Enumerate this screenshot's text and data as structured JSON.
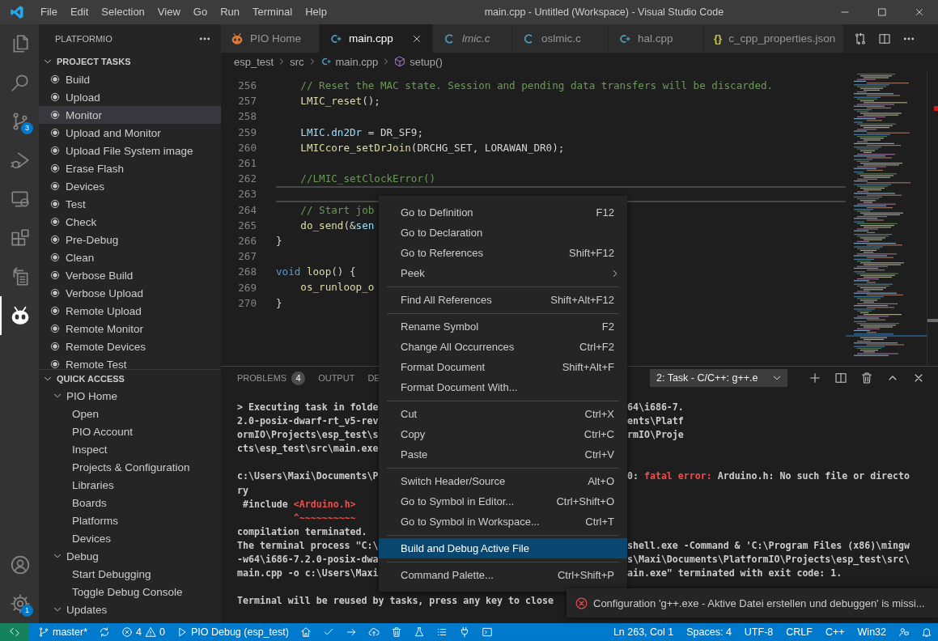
{
  "title_bar": {
    "menu": [
      "File",
      "Edit",
      "Selection",
      "View",
      "Go",
      "Run",
      "Terminal",
      "Help"
    ],
    "title": "main.cpp - Untitled (Workspace) - Visual Studio Code"
  },
  "activity_bar": {
    "items": [
      {
        "kind": "files",
        "selected": false
      },
      {
        "kind": "search",
        "selected": false
      },
      {
        "kind": "scm",
        "selected": false,
        "badge": "3"
      },
      {
        "kind": "debug",
        "selected": false
      },
      {
        "kind": "remote",
        "selected": false
      },
      {
        "kind": "extensions",
        "selected": false
      },
      {
        "kind": "tasks",
        "selected": false
      },
      {
        "kind": "platformio",
        "selected": true
      }
    ],
    "bottom": [
      {
        "kind": "account",
        "selected": false
      },
      {
        "kind": "settings",
        "selected": false,
        "badge": "1"
      }
    ]
  },
  "sidebar": {
    "title": "PLATFORMIO",
    "sections": [
      {
        "kind": "tasks",
        "title": "PROJECT TASKS",
        "expanded": true,
        "items": [
          {
            "label": "Build",
            "selected": false
          },
          {
            "label": "Upload",
            "selected": false
          },
          {
            "label": "Monitor",
            "selected": true
          },
          {
            "label": "Upload and Monitor",
            "selected": false
          },
          {
            "label": "Upload File System image",
            "selected": false
          },
          {
            "label": "Erase Flash",
            "selected": false
          },
          {
            "label": "Devices",
            "selected": false
          },
          {
            "label": "Test",
            "selected": false
          },
          {
            "label": "Check",
            "selected": false
          },
          {
            "label": "Pre-Debug",
            "selected": false
          },
          {
            "label": "Clean",
            "selected": false
          },
          {
            "label": "Verbose Build",
            "selected": false
          },
          {
            "label": "Verbose Upload",
            "selected": false
          },
          {
            "label": "Remote Upload",
            "selected": false
          },
          {
            "label": "Remote Monitor",
            "selected": false
          },
          {
            "label": "Remote Devices",
            "selected": false
          },
          {
            "label": "Remote Test",
            "selected": false
          }
        ]
      },
      {
        "kind": "tree",
        "title": "QUICK ACCESS",
        "expanded": true,
        "items": [
          {
            "label": "PIO Home",
            "expanded": true,
            "children": [
              {
                "label": "Open"
              },
              {
                "label": "PIO Account"
              },
              {
                "label": "Inspect"
              },
              {
                "label": "Projects & Configuration"
              },
              {
                "label": "Libraries"
              },
              {
                "label": "Boards"
              },
              {
                "label": "Platforms"
              },
              {
                "label": "Devices"
              }
            ]
          },
          {
            "label": "Debug",
            "expanded": true,
            "children": [
              {
                "label": "Start Debugging"
              },
              {
                "label": "Toggle Debug Console"
              }
            ]
          },
          {
            "label": "Updates",
            "expanded": true
          }
        ]
      }
    ]
  },
  "editor": {
    "tabs": [
      {
        "label": "PIO Home",
        "kind": "pio",
        "selected": false,
        "preview": false
      },
      {
        "label": "main.cpp",
        "kind": "cpp",
        "selected": true,
        "preview": false
      },
      {
        "label": "lmic.c",
        "kind": "c",
        "selected": false,
        "preview": true
      },
      {
        "label": "oslmic.c",
        "kind": "c",
        "selected": false,
        "preview": false
      },
      {
        "label": "hal.cpp",
        "kind": "cpp",
        "selected": false,
        "preview": false
      },
      {
        "label": "c_cpp_properties.json",
        "kind": "json",
        "glyph": "{}",
        "selected": false,
        "preview": false
      }
    ],
    "breadcrumbs": [
      {
        "label": "esp_test",
        "kind": "folder"
      },
      {
        "label": "src",
        "kind": "folder"
      },
      {
        "label": "main.cpp",
        "kind": "cpp"
      },
      {
        "label": "setup()",
        "kind": "function"
      }
    ],
    "lines": [
      {
        "number": "256",
        "current": false,
        "tokens": [
          {
            "color": "#6a9955",
            "text": "    // Reset the MAC state. Session and pending data transfers will be discarded."
          }
        ]
      },
      {
        "number": "257",
        "current": false,
        "tokens": [
          {
            "color": "#dcdcaa",
            "text": "    LMIC_reset"
          },
          {
            "color": "#d4d4d4",
            "text": "();"
          }
        ]
      },
      {
        "number": "258",
        "current": false
      },
      {
        "number": "259",
        "current": false,
        "tokens": [
          {
            "color": "#9cdcfe",
            "text": "    LMIC.dn2Dr"
          },
          {
            "color": "#d4d4d4",
            "text": " = DR_SF9;"
          }
        ]
      },
      {
        "number": "260",
        "current": false,
        "tokens": [
          {
            "color": "#dcdcaa",
            "text": "    LMICcore_setDrJoin"
          },
          {
            "color": "#d4d4d4",
            "text": "(DRCHG_SET, LORAWAN_DR0);"
          }
        ]
      },
      {
        "number": "261",
        "current": false
      },
      {
        "number": "262",
        "current": false,
        "tokens": [
          {
            "color": "#6a9955",
            "text": "    //LMIC_setClockError()"
          }
        ]
      },
      {
        "number": "263",
        "current": true
      },
      {
        "number": "264",
        "current": false,
        "tokens": [
          {
            "color": "#6a9955",
            "text": "    // Start job"
          }
        ]
      },
      {
        "number": "265",
        "current": false,
        "tokens": [
          {
            "color": "#dcdcaa",
            "text": "    do_send"
          },
          {
            "color": "#d4d4d4",
            "text": "(&"
          },
          {
            "color": "#9cdcfe",
            "text": "sen"
          }
        ]
      },
      {
        "number": "266",
        "current": false,
        "tokens": [
          {
            "color": "#d4d4d4",
            "text": "}"
          }
        ]
      },
      {
        "number": "267",
        "current": false
      },
      {
        "number": "268",
        "current": false,
        "tokens": [
          {
            "color": "#569cd6",
            "text": "void"
          },
          {
            "color": "#dcdcaa",
            "text": " loop"
          },
          {
            "color": "#d4d4d4",
            "text": "() {"
          }
        ]
      },
      {
        "number": "269",
        "current": false,
        "tokens": [
          {
            "color": "#dcdcaa",
            "text": "    os_runloop_o"
          }
        ]
      },
      {
        "number": "270",
        "current": false,
        "tokens": [
          {
            "color": "#d4d4d4",
            "text": "}"
          }
        ]
      }
    ]
  },
  "panel": {
    "tabs": [
      {
        "label": "PROBLEMS",
        "badge": "4",
        "selected": false
      },
      {
        "label": "OUTPUT",
        "selected": false
      },
      {
        "label": "DE",
        "selected": false
      }
    ],
    "task_select": "2: Task - C/C++: g++.e",
    "terminal": [
      {
        "kind": "line",
        "left": [
          {
            "color": "#cccccc",
            "text": "> Executing task in folde"
          }
        ],
        "right": [
          {
            "color": "#cccccc",
            "text": "64\\i686-7."
          }
        ]
      },
      {
        "kind": "line",
        "left": [
          {
            "color": "#cccccc",
            "text": "2.0-posix-dwarf-rt_v5-rev"
          }
        ],
        "right": [
          {
            "color": "#cccccc",
            "text": "ents\\Platf"
          }
        ]
      },
      {
        "kind": "line",
        "left": [
          {
            "color": "#cccccc",
            "text": "ormIO\\Projects\\esp_test\\s"
          }
        ],
        "right": [
          {
            "color": "#cccccc",
            "text": "rmIO\\Proje"
          }
        ]
      },
      {
        "kind": "line",
        "left": [
          {
            "color": "#cccccc",
            "text": "cts\\esp_test\\src\\main.exe"
          }
        ]
      },
      {
        "kind": "blank"
      },
      {
        "kind": "line",
        "left": [
          {
            "color": "#cccccc",
            "text": "c:\\Users\\Maxi\\Documents\\P"
          }
        ],
        "right": [
          {
            "color": "#cccccc",
            "text": "0: "
          },
          {
            "color": "#f14c4c",
            "text": "fatal error:"
          },
          {
            "color": "#cccccc",
            "text": " Arduino.h: No such file or directo"
          }
        ]
      },
      {
        "kind": "line",
        "left": [
          {
            "color": "#cccccc",
            "text": "ry"
          }
        ]
      },
      {
        "kind": "line",
        "left": [
          {
            "color": "#cccccc",
            "text": " #include "
          },
          {
            "color": "#f14c4c",
            "text": "<Arduino.h>"
          }
        ]
      },
      {
        "kind": "line",
        "left": [
          {
            "color": "#f14c4c",
            "text": "          ^~~~~~~~~~~"
          }
        ]
      },
      {
        "kind": "line",
        "left": [
          {
            "color": "#cccccc",
            "text": "compilation terminated."
          }
        ]
      },
      {
        "kind": "line",
        "left": [
          {
            "color": "#cccccc",
            "text": "The terminal process \"C:\\"
          }
        ],
        "right": [
          {
            "color": "#cccccc",
            "text": "shell.exe -Command & 'C:\\Program Files (x86)\\mingw"
          }
        ]
      },
      {
        "kind": "line",
        "left": [
          {
            "color": "#cccccc",
            "text": "-w64\\i686-7.2.0-posix-dwa"
          }
        ],
        "right": [
          {
            "color": "#cccccc",
            "text": "s\\Maxi\\Documents\\PlatformIO\\Projects\\esp_test\\src\\"
          }
        ]
      },
      {
        "kind": "line",
        "left": [
          {
            "color": "#cccccc",
            "text": "main.cpp -o c:\\Users\\Maxi"
          }
        ],
        "right": [
          {
            "color": "#cccccc",
            "text": "ain.exe\" terminated with exit code: 1."
          }
        ]
      },
      {
        "kind": "blank"
      },
      {
        "kind": "line",
        "left": [
          {
            "color": "#cccccc",
            "text": "Terminal will be reused by tasks, press any key to close"
          }
        ]
      }
    ]
  },
  "context_menu": {
    "items": [
      {
        "kind": "item",
        "label": "Go to Definition",
        "shortcut": "F12",
        "submenu": false,
        "selected": false
      },
      {
        "kind": "item",
        "label": "Go to Declaration",
        "submenu": false,
        "selected": false
      },
      {
        "kind": "item",
        "label": "Go to References",
        "shortcut": "Shift+F12",
        "submenu": false,
        "selected": false
      },
      {
        "kind": "item",
        "label": "Peek",
        "submenu": true,
        "selected": false
      },
      {
        "kind": "separator"
      },
      {
        "kind": "item",
        "label": "Find All References",
        "shortcut": "Shift+Alt+F12",
        "submenu": false,
        "selected": false
      },
      {
        "kind": "separator"
      },
      {
        "kind": "item",
        "label": "Rename Symbol",
        "shortcut": "F2",
        "submenu": false,
        "selected": false
      },
      {
        "kind": "item",
        "label": "Change All Occurrences",
        "shortcut": "Ctrl+F2",
        "submenu": false,
        "selected": false
      },
      {
        "kind": "item",
        "label": "Format Document",
        "shortcut": "Shift+Alt+F",
        "submenu": false,
        "selected": false
      },
      {
        "kind": "item",
        "label": "Format Document With...",
        "submenu": false,
        "selected": false
      },
      {
        "kind": "separator"
      },
      {
        "kind": "item",
        "label": "Cut",
        "shortcut": "Ctrl+X",
        "submenu": false,
        "selected": false
      },
      {
        "kind": "item",
        "label": "Copy",
        "shortcut": "Ctrl+C",
        "submenu": false,
        "selected": false
      },
      {
        "kind": "item",
        "label": "Paste",
        "shortcut": "Ctrl+V",
        "submenu": false,
        "selected": false
      },
      {
        "kind": "separator"
      },
      {
        "kind": "item",
        "label": "Switch Header/Source",
        "shortcut": "Alt+O",
        "submenu": false,
        "selected": false
      },
      {
        "kind": "item",
        "label": "Go to Symbol in Editor...",
        "shortcut": "Ctrl+Shift+O",
        "submenu": false,
        "selected": false
      },
      {
        "kind": "item",
        "label": "Go to Symbol in Workspace...",
        "shortcut": "Ctrl+T",
        "submenu": false,
        "selected": false
      },
      {
        "kind": "separator"
      },
      {
        "kind": "item",
        "label": "Build and Debug Active File",
        "submenu": false,
        "selected": true
      },
      {
        "kind": "separator"
      },
      {
        "kind": "item",
        "label": "Command Palette...",
        "shortcut": "Ctrl+Shift+P",
        "submenu": false,
        "selected": false
      }
    ]
  },
  "notification": {
    "kind": "error",
    "message": "Configuration 'g++.exe - Aktive Datei erstellen und debuggen' is missi..."
  },
  "status_bar": {
    "left": [
      {
        "kind": "remote"
      },
      {
        "kind": "branch",
        "text": "master*"
      },
      {
        "kind": "sync"
      },
      {
        "kind": "problems",
        "errors": "4",
        "warnings": "0"
      },
      {
        "kind": "debug",
        "text": "PIO Debug (esp_test)"
      },
      {
        "kind": "home"
      },
      {
        "kind": "check"
      },
      {
        "kind": "arrow"
      },
      {
        "kind": "upload"
      },
      {
        "kind": "trash"
      },
      {
        "kind": "flask"
      },
      {
        "kind": "list"
      },
      {
        "kind": "plug"
      },
      {
        "kind": "terminal"
      }
    ],
    "right": [
      {
        "kind": "text",
        "text": "Ln 263, Col 1"
      },
      {
        "kind": "text",
        "text": "Spaces: 4"
      },
      {
        "kind": "text",
        "text": "UTF-8"
      },
      {
        "kind": "text",
        "text": "CRLF"
      },
      {
        "kind": "text",
        "text": "C++"
      },
      {
        "kind": "text",
        "text": "Win32"
      },
      {
        "kind": "feedback"
      },
      {
        "kind": "bell"
      }
    ]
  }
}
